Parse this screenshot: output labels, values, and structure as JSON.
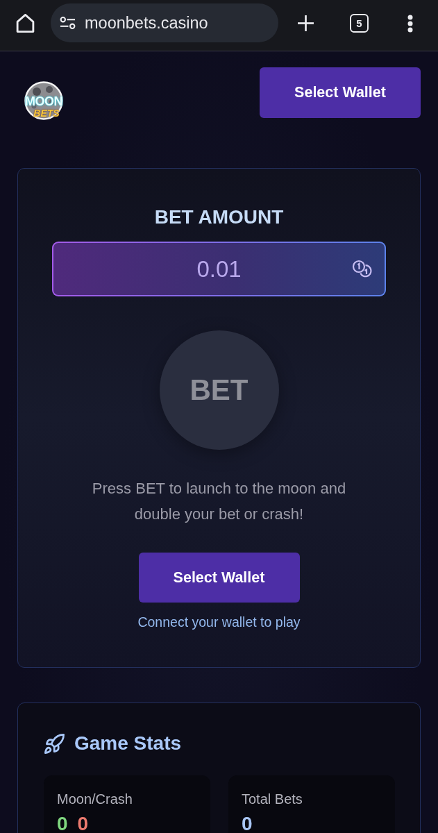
{
  "browser": {
    "url": "moonbets.casino",
    "tab_count": "5"
  },
  "header": {
    "logo": {
      "line_1": "MOON",
      "line_2": "BETS"
    },
    "wallet_button": "Select Wallet"
  },
  "bet_card": {
    "title": "BET AMOUNT",
    "amount": {
      "value": "0.01"
    },
    "bet_button": {
      "label": "BET",
      "disabled": true
    },
    "description": "Press BET to launch to the moon and double your bet or crash!",
    "wallet_button": "Select Wallet",
    "hint": "Connect your wallet to play"
  },
  "stats": {
    "title": "Game Stats",
    "items": [
      {
        "label": "Moon/Crash",
        "values": [
          {
            "text": "0",
            "kind": "win"
          },
          {
            "text": "0",
            "kind": "loss"
          }
        ]
      },
      {
        "label": "Total Bets",
        "values": [
          {
            "text": "0",
            "kind": "count"
          }
        ]
      }
    ]
  }
}
